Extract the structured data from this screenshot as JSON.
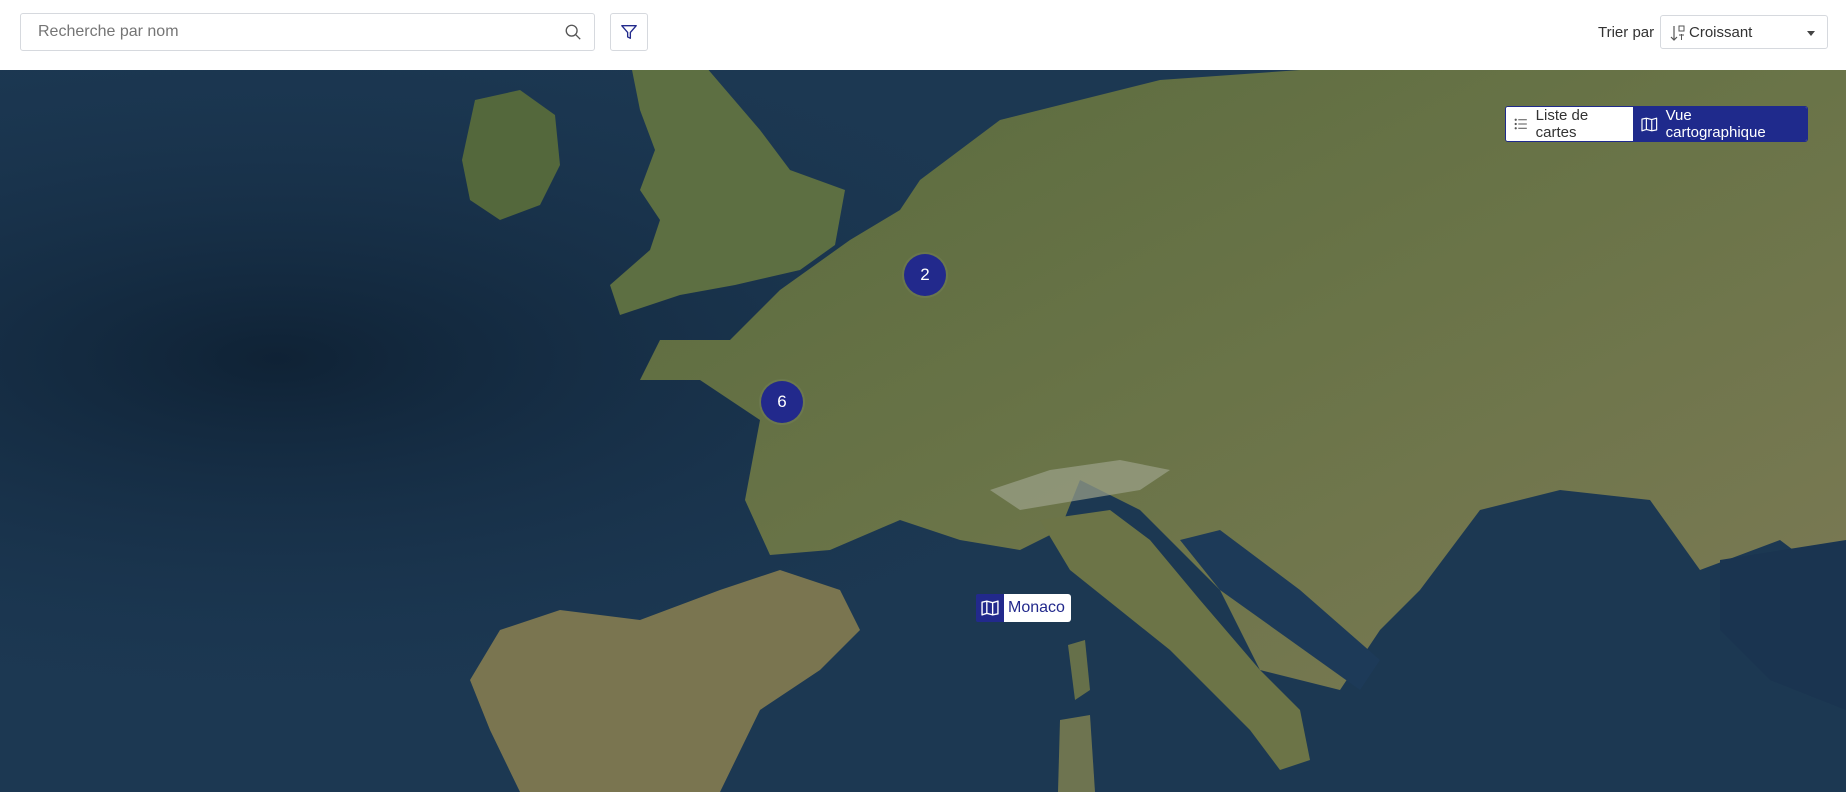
{
  "search": {
    "placeholder": "Recherche par nom",
    "value": ""
  },
  "icons": {
    "search": "search-icon",
    "filter": "filter-icon",
    "sort": "sort-ascending-icon",
    "caret": "chevron-down-icon",
    "list": "list-icon",
    "map": "map-icon"
  },
  "sort": {
    "label": "Trier par",
    "value": "Croissant"
  },
  "view_toggle": {
    "list_label": "Liste de cartes",
    "map_label": "Vue cartographique",
    "active": "map"
  },
  "map": {
    "clusters": [
      {
        "count": "2"
      },
      {
        "count": "6"
      }
    ],
    "markers": [
      {
        "label": "Monaco"
      }
    ]
  },
  "colors": {
    "accent": "#22298c",
    "sea": "#1a3550",
    "land": "#5f6e45"
  }
}
